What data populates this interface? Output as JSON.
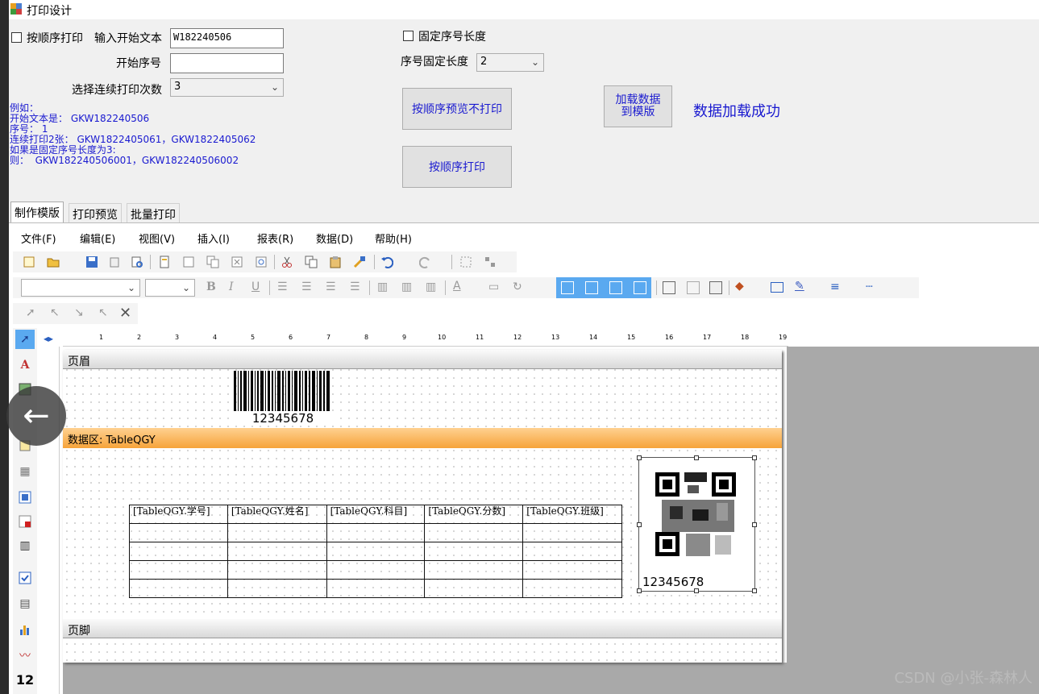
{
  "window": {
    "title": "打印设计"
  },
  "form": {
    "seq_print_label": "按顺序打印",
    "start_text_label": "输入开始文本",
    "start_text_value": "W182240506",
    "start_seq_label": "开始序号",
    "start_seq_value": "",
    "repeat_label": "选择连续打印次数",
    "repeat_value": "3",
    "fixed_len_label": "固定序号长度",
    "seq_len_label": "序号固定长度",
    "seq_len_value": "2",
    "btn_preview": "按顺序预览不打印",
    "btn_print": "按顺序打印",
    "btn_load": "加载数据\n到模版",
    "load_status": "数据加载成功",
    "example_lines": [
      "例如：",
      "开始文本是： GKW182240506",
      "序号： 1",
      "连续打印2张： GKW1822405061，GKW1822405062",
      "如果是固定序号长度为3:",
      "则：  GKW182240506001，GKW182240506002"
    ]
  },
  "tabs": [
    "制作模版",
    "打印预览",
    "批量打印"
  ],
  "menu": [
    "文件(F)",
    "编辑(E)",
    "视图(V)",
    "插入(I)",
    "报表(R)",
    "数据(D)",
    "帮助(H)"
  ],
  "ruler_numbers": [
    "1",
    "2",
    "3",
    "4",
    "5",
    "6",
    "7",
    "8",
    "9",
    "10",
    "11",
    "12",
    "13",
    "14",
    "15",
    "16",
    "17",
    "18",
    "19"
  ],
  "designer": {
    "header_band": "页眉",
    "data_band": "数据区: TableQGY",
    "footer_band": "页脚",
    "barcode_text": "12345678",
    "qr_text": "12345678",
    "table_headers": [
      "[TableQGY.学号]",
      "[TableQGY.姓名]",
      "[TableQGY.科目]",
      "[TableQGY.分数]",
      "[TableQGY.班级]"
    ]
  },
  "left_tool_label": "12",
  "watermark": "CSDN @小张-森林人"
}
